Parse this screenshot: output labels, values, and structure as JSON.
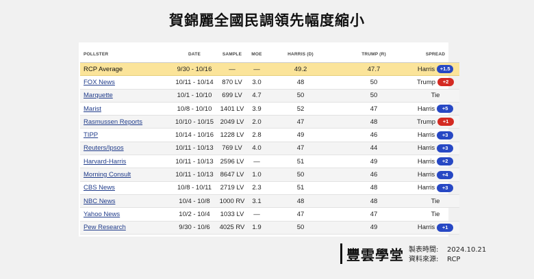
{
  "title": "賀錦麗全國民調領先幅度縮小",
  "columns": {
    "pollster": "POLLSTER",
    "date": "DATE",
    "sample": "SAMPLE",
    "moe": "MoE",
    "harris": "HARRIS (D)",
    "trump": "TRUMP (R)",
    "spread": "SPREAD"
  },
  "rows": [
    {
      "pollster": "RCP Average",
      "date": "9/30 - 10/16",
      "sample": "—",
      "moe": "—",
      "harris": "49.2",
      "trump": "47.7",
      "spread_name": "Harris",
      "spread_value": "+1.5",
      "spread_party": "harris"
    },
    {
      "pollster": "FOX News",
      "date": "10/11 - 10/14",
      "sample": "870 LV",
      "moe": "3.0",
      "harris": "48",
      "trump": "50",
      "spread_name": "Trump",
      "spread_value": "+2",
      "spread_party": "trump"
    },
    {
      "pollster": "Marquette",
      "date": "10/1 - 10/10",
      "sample": "699 LV",
      "moe": "4.7",
      "harris": "50",
      "trump": "50",
      "spread_name": "Tie",
      "spread_value": "",
      "spread_party": "tie"
    },
    {
      "pollster": "Marist",
      "date": "10/8 - 10/10",
      "sample": "1401 LV",
      "moe": "3.9",
      "harris": "52",
      "trump": "47",
      "spread_name": "Harris",
      "spread_value": "+5",
      "spread_party": "harris"
    },
    {
      "pollster": "Rasmussen Reports",
      "date": "10/10 - 10/15",
      "sample": "2049 LV",
      "moe": "2.0",
      "harris": "47",
      "trump": "48",
      "spread_name": "Trump",
      "spread_value": "+1",
      "spread_party": "trump"
    },
    {
      "pollster": "TIPP",
      "date": "10/14 - 10/16",
      "sample": "1228 LV",
      "moe": "2.8",
      "harris": "49",
      "trump": "46",
      "spread_name": "Harris",
      "spread_value": "+3",
      "spread_party": "harris"
    },
    {
      "pollster": "Reuters/Ipsos",
      "date": "10/11 - 10/13",
      "sample": "769 LV",
      "moe": "4.0",
      "harris": "47",
      "trump": "44",
      "spread_name": "Harris",
      "spread_value": "+3",
      "spread_party": "harris"
    },
    {
      "pollster": "Harvard-Harris",
      "date": "10/11 - 10/13",
      "sample": "2596 LV",
      "moe": "—",
      "harris": "51",
      "trump": "49",
      "spread_name": "Harris",
      "spread_value": "+2",
      "spread_party": "harris"
    },
    {
      "pollster": "Morning Consult",
      "date": "10/11 - 10/13",
      "sample": "8647 LV",
      "moe": "1.0",
      "harris": "50",
      "trump": "46",
      "spread_name": "Harris",
      "spread_value": "+4",
      "spread_party": "harris"
    },
    {
      "pollster": "CBS News",
      "date": "10/8 - 10/11",
      "sample": "2719 LV",
      "moe": "2.3",
      "harris": "51",
      "trump": "48",
      "spread_name": "Harris",
      "spread_value": "+3",
      "spread_party": "harris"
    },
    {
      "pollster": "NBC News",
      "date": "10/4 - 10/8",
      "sample": "1000 RV",
      "moe": "3.1",
      "harris": "48",
      "trump": "48",
      "spread_name": "Tie",
      "spread_value": "",
      "spread_party": "tie"
    },
    {
      "pollster": "Yahoo News",
      "date": "10/2 - 10/4",
      "sample": "1033 LV",
      "moe": "—",
      "harris": "47",
      "trump": "47",
      "spread_name": "Tie",
      "spread_value": "",
      "spread_party": "tie"
    },
    {
      "pollster": "Pew Research",
      "date": "9/30 - 10/6",
      "sample": "4025 RV",
      "moe": "1.9",
      "harris": "50",
      "trump": "49",
      "spread_name": "Harris",
      "spread_value": "+1",
      "spread_party": "harris"
    }
  ],
  "footer": {
    "logo": "豐雲學堂",
    "made_label": "製表時間:",
    "made_value": "2024.10.21",
    "source_label": "資料來源:",
    "source_value": "RCP"
  },
  "colors": {
    "harris": "#2748c4",
    "trump": "#d42a22",
    "average_highlight": "#fbe49a"
  }
}
